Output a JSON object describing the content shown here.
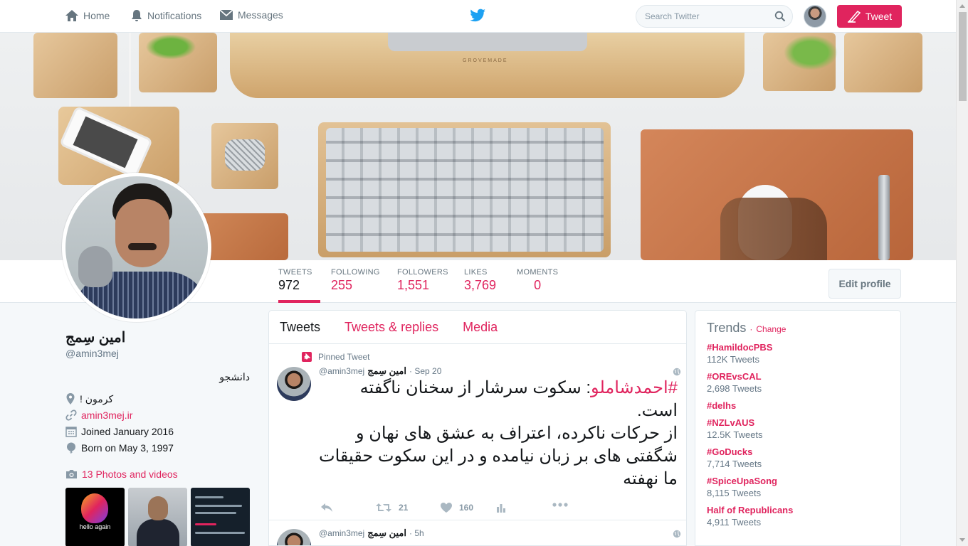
{
  "nav": {
    "home": "Home",
    "notifications": "Notifications",
    "messages": "Messages",
    "search_placeholder": "Search Twitter",
    "tweet_button": "Tweet"
  },
  "banner": {
    "brand": "GROVEMADE"
  },
  "stats": [
    {
      "label": "TWEETS",
      "value": "972"
    },
    {
      "label": "FOLLOWING",
      "value": "255"
    },
    {
      "label": "FOLLOWERS",
      "value": "1,551"
    },
    {
      "label": "LIKES",
      "value": "3,769"
    },
    {
      "label": "MOMENTS",
      "value": "0"
    }
  ],
  "edit_profile": "Edit profile",
  "profile": {
    "name": "امین سِمج",
    "handle": "@amin3mej",
    "bio": "دانشجو",
    "location": "کرمون !",
    "website": "amin3mej.ir",
    "joined": "Joined January 2016",
    "born": "Born on May 3, 1997",
    "photos": "13 Photos and videos",
    "thumb1_caption": "hello again"
  },
  "tabs": [
    "Tweets",
    "Tweets & replies",
    "Media"
  ],
  "tweets": [
    {
      "pinned_label": "Pinned Tweet",
      "name": "امین سِمج",
      "handle": "@amin3mej",
      "time": "· Sep 20",
      "hashtag": "#احمدشاملو",
      "text_after_hashtag": ": سکوت سرشار از سخنان ناگفته است.",
      "text_rest": "از حرکات ناکرده، اعتراف به عشق های نهان و شگفتی های بر زبان نیامده و در این سکوت حقیقات ما نهفته",
      "retweets": "21",
      "likes": "160"
    },
    {
      "name": "امین سِمج",
      "handle": "@amin3mej",
      "time": "· 5h"
    }
  ],
  "trends": {
    "title": "Trends",
    "separator": "·",
    "change": "Change",
    "items": [
      {
        "tag": "#HamildocPBS",
        "count": "112K Tweets"
      },
      {
        "tag": "#OREvsCAL",
        "count": "2,698 Tweets"
      },
      {
        "tag": "#delhs",
        "count": ""
      },
      {
        "tag": "#NZLvAUS",
        "count": "12.5K Tweets"
      },
      {
        "tag": "#GoDucks",
        "count": "7,714 Tweets"
      },
      {
        "tag": "#SpiceUpaSong",
        "count": "8,115 Tweets"
      },
      {
        "tag": "Half of Republicans",
        "count": "4,911 Tweets"
      }
    ]
  },
  "colors": {
    "accent": "#e0245e",
    "twitter_blue": "#1da1f2"
  }
}
